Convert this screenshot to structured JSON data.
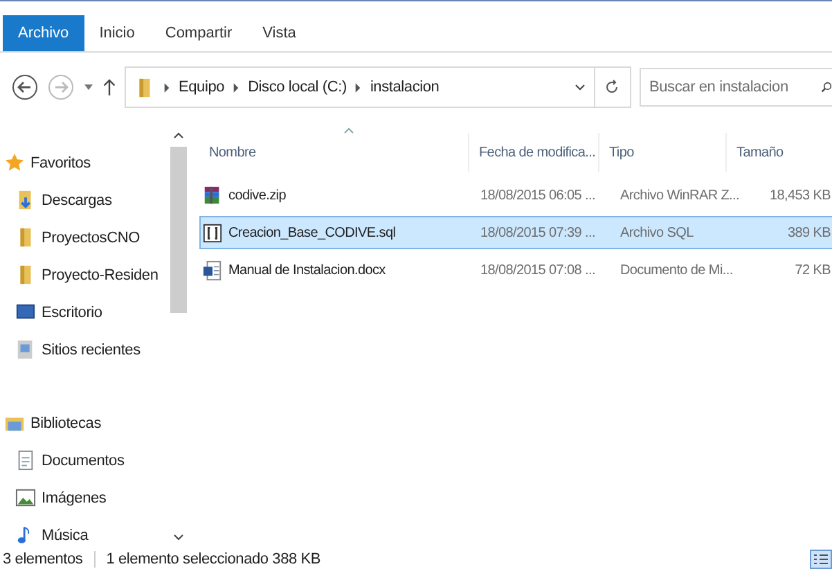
{
  "ribbon_tabs": [
    {
      "label": "Archivo",
      "selected": true
    },
    {
      "label": "Inicio",
      "selected": false
    },
    {
      "label": "Compartir",
      "selected": false
    },
    {
      "label": "Vista",
      "selected": false
    }
  ],
  "address_bar": {
    "path": [
      "Equipo",
      "Disco local (C:)",
      "instalacion"
    ]
  },
  "search": {
    "placeholder": "Buscar en instalacion"
  },
  "nav_pane": {
    "groups": [
      {
        "label": "Favoritos",
        "kind": "star",
        "children": [
          {
            "label": "Descargas",
            "kind": "downloads"
          },
          {
            "label": "ProyectosCNO",
            "kind": "folder"
          },
          {
            "label": "Proyecto-Residen",
            "kind": "folder"
          },
          {
            "label": "Escritorio",
            "kind": "desktop"
          },
          {
            "label": "Sitios recientes",
            "kind": "recent"
          }
        ]
      },
      {
        "label": "Bibliotecas",
        "kind": "library",
        "children": [
          {
            "label": "Documentos",
            "kind": "documents"
          },
          {
            "label": "Imágenes",
            "kind": "images"
          },
          {
            "label": "Música",
            "kind": "music"
          }
        ]
      }
    ]
  },
  "table": {
    "columns": [
      "Nombre",
      "Fecha de modifica...",
      "Tipo",
      "Tamaño"
    ],
    "rows": [
      {
        "kind": "zip",
        "name": "codive.zip",
        "date": "18/08/2015 06:05 ...",
        "type": "Archivo WinRAR Z...",
        "size": "18,453 KB",
        "selected": false
      },
      {
        "kind": "sql",
        "name": "Creacion_Base_CODIVE.sql",
        "date": "18/08/2015 07:39 ...",
        "type": "Archivo SQL",
        "size": "389 KB",
        "selected": true
      },
      {
        "kind": "docx",
        "name": "Manual de Instalacion.docx",
        "date": "18/08/2015 07:08 ...",
        "type": "Documento de Mi...",
        "size": "72 KB",
        "selected": false
      }
    ]
  },
  "status_bar": {
    "item_count": "3 elementos",
    "selection": "1 elemento seleccionado  388 KB"
  }
}
